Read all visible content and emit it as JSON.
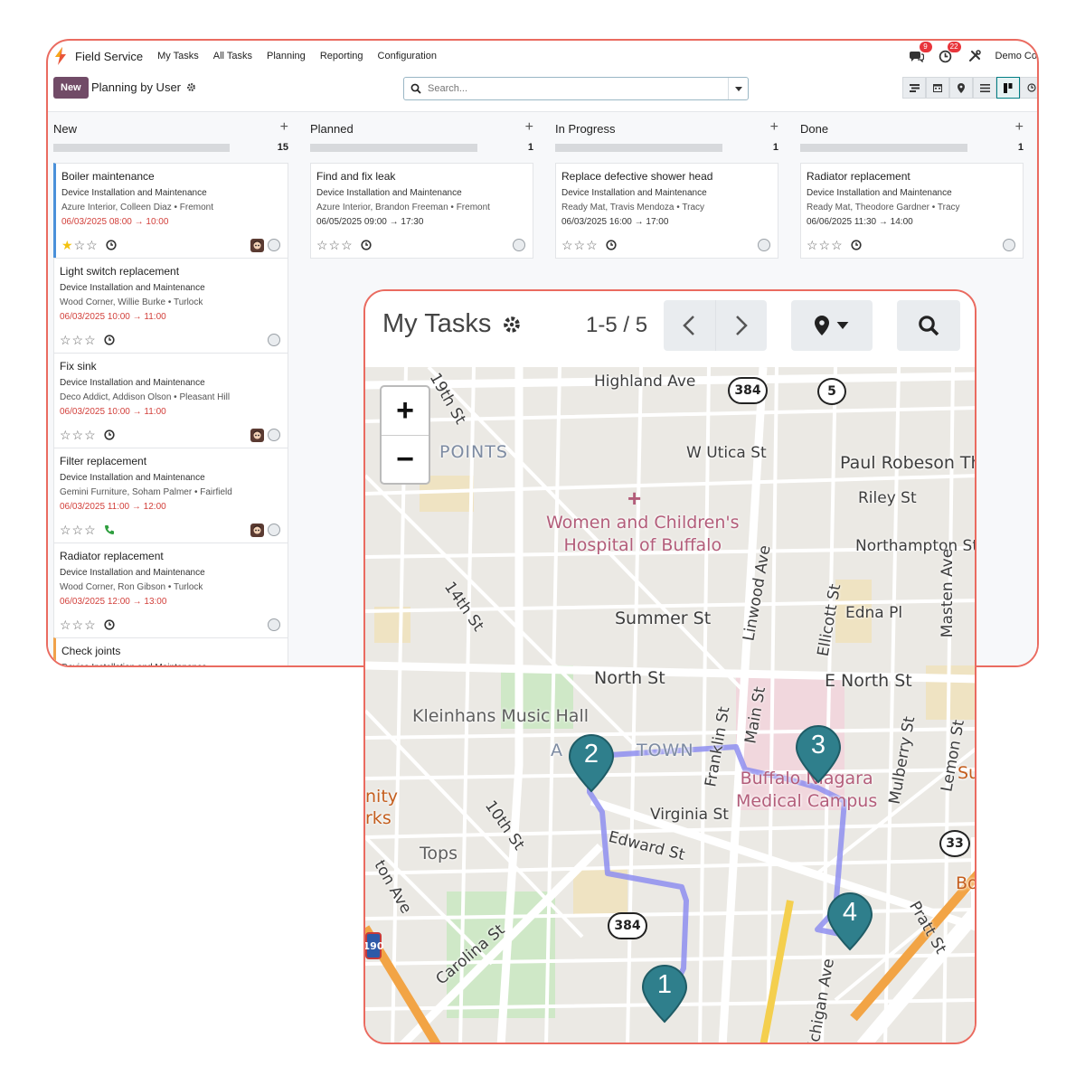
{
  "app": {
    "name": "Field Service",
    "menu": [
      "My Tasks",
      "All Tasks",
      "Planning",
      "Reporting",
      "Configuration"
    ],
    "messages_badge": "9",
    "activities_badge": "22",
    "company": "Demo Co"
  },
  "controls": {
    "new_label": "New",
    "view_title": "Planning by User",
    "search_placeholder": "Search..."
  },
  "columns": [
    {
      "title": "New",
      "count": "15",
      "cards": [
        {
          "title": "Boiler maintenance",
          "project": "Device Installation and Maintenance",
          "people": "Azure Interior, Colleen Diaz • Fremont",
          "date": "06/03/2025 08:00 → 10:00",
          "stars": 1,
          "icon": "clock",
          "avatar": true
        },
        {
          "title": "Light switch replacement",
          "project": "Device Installation and Maintenance",
          "people": "Wood Corner, Willie Burke • Turlock",
          "date": "06/03/2025 10:00 → 11:00",
          "stars": 0,
          "icon": "clock",
          "avatar": false
        },
        {
          "title": "Fix sink",
          "project": "Device Installation and Maintenance",
          "people": "Deco Addict, Addison Olson • Pleasant Hill",
          "date": "06/03/2025 10:00 → 11:00",
          "stars": 0,
          "icon": "clock",
          "avatar": true
        },
        {
          "title": "Filter replacement",
          "project": "Device Installation and Maintenance",
          "people": "Gemini Furniture, Soham Palmer • Fairfield",
          "date": "06/03/2025 11:00 → 12:00",
          "stars": 0,
          "icon": "phone",
          "avatar": true
        },
        {
          "title": "Radiator replacement",
          "project": "Device Installation and Maintenance",
          "people": "Wood Corner, Ron Gibson • Turlock",
          "date": "06/03/2025 12:00 → 13:00",
          "stars": 0,
          "icon": "clock",
          "avatar": false
        },
        {
          "title": "Check joints",
          "project": "Device Installation and Maintenance",
          "people": "",
          "date": "",
          "stars": 0,
          "icon": "",
          "avatar": false
        }
      ]
    },
    {
      "title": "Planned",
      "count": "1",
      "cards": [
        {
          "title": "Find and fix leak",
          "project": "Device Installation and Maintenance",
          "people": "Azure Interior, Brandon Freeman • Fremont",
          "date": "06/05/2025 09:00 → 17:30",
          "stars": 0,
          "icon": "clock",
          "avatar": false
        }
      ]
    },
    {
      "title": "In Progress",
      "count": "1",
      "cards": [
        {
          "title": "Replace defective shower head",
          "project": "Device Installation and Maintenance",
          "people": "Ready Mat, Travis Mendoza • Tracy",
          "date": "06/03/2025 16:00 → 17:00",
          "stars": 0,
          "icon": "clock",
          "avatar": false
        }
      ]
    },
    {
      "title": "Done",
      "count": "1",
      "cards": [
        {
          "title": "Radiator replacement",
          "project": "Device Installation and Maintenance",
          "people": "Ready Mat, Theodore Gardner • Tracy",
          "date": "06/06/2025 11:30 → 14:00",
          "stars": 0,
          "icon": "clock",
          "avatar": false
        }
      ]
    }
  ],
  "map_view": {
    "title": "My Tasks",
    "pager": "1-5 / 5",
    "zoom_in": "+",
    "zoom_out": "−",
    "streets": [
      "Highland Ave",
      "W Utica St",
      "Paul Robeson Th",
      "Riley St",
      "Northampton St",
      "Summer St",
      "Edna Pl",
      "North St",
      "E North St",
      "Kleinhans Music Hall",
      "Virginia St",
      "Edward St",
      "Tops",
      "Carolina St",
      "14th St",
      "10th St",
      "Linwood Ave",
      "Ellicott St",
      "Masten Ave",
      "Main St",
      "Franklin St",
      "Mulberry St",
      "Lemon St",
      "Pratt St",
      "Michigan Ave",
      "POINTS",
      "A",
      "TOWN",
      "nity",
      "rks",
      "Su",
      "Bo",
      "ton Ave",
      "19th St"
    ],
    "hospital": [
      "Women and Children's",
      "Hospital of Buffalo"
    ],
    "campus": [
      "Buffalo Niagara",
      "Medical Campus"
    ],
    "shields": [
      "384",
      "5",
      "33",
      "384",
      "190"
    ],
    "pins": [
      "1",
      "2",
      "3",
      "4"
    ],
    "route_color": "#8f8ff0",
    "pin_color": "#2f7f8c"
  }
}
